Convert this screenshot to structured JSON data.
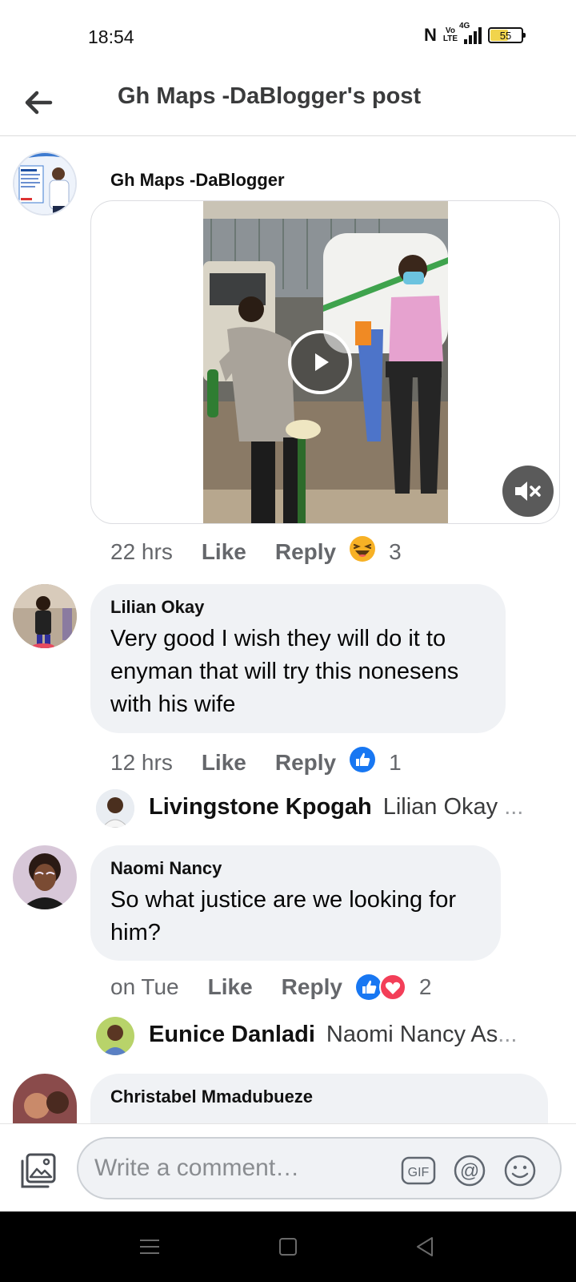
{
  "status": {
    "time": "18:54",
    "network": "4G",
    "volte": "Vo LTE",
    "battery": "55"
  },
  "header": {
    "title": "Gh Maps -DaBlogger's post"
  },
  "post": {
    "author": "Gh Maps -DaBlogger",
    "time": "22 hrs",
    "like_label": "Like",
    "reply_label": "Reply",
    "reaction_count": "3"
  },
  "comments": [
    {
      "name": "Lilian Okay",
      "text": "Very good I wish they will do it to enyman that will try this nonesens with his wife",
      "time": "12 hrs",
      "like_label": "Like",
      "reply_label": "Reply",
      "reaction_count": "1",
      "reply": {
        "name": "Livingstone Kpogah",
        "text": "Lilian Okay",
        "ellipsis": "..."
      }
    },
    {
      "name": "Naomi Nancy",
      "text": "So what justice are we looking for him?",
      "time": "on Tue",
      "like_label": "Like",
      "reply_label": "Reply",
      "reaction_count": "2",
      "reply": {
        "name": "Eunice Danladi",
        "text": "Naomi Nancy As",
        "ellipsis": "..."
      }
    },
    {
      "name": "Christabel Mmadubueze"
    }
  ],
  "composer": {
    "placeholder": "Write a comment…",
    "gif_label": "GIF",
    "at_label": "@"
  },
  "colors": {
    "like_blue": "#1877f2",
    "heart_red": "#f33e58",
    "haha_yellow": "#f7b125",
    "bubble_bg": "#f0f2f5",
    "meta_grey": "#65676b"
  }
}
